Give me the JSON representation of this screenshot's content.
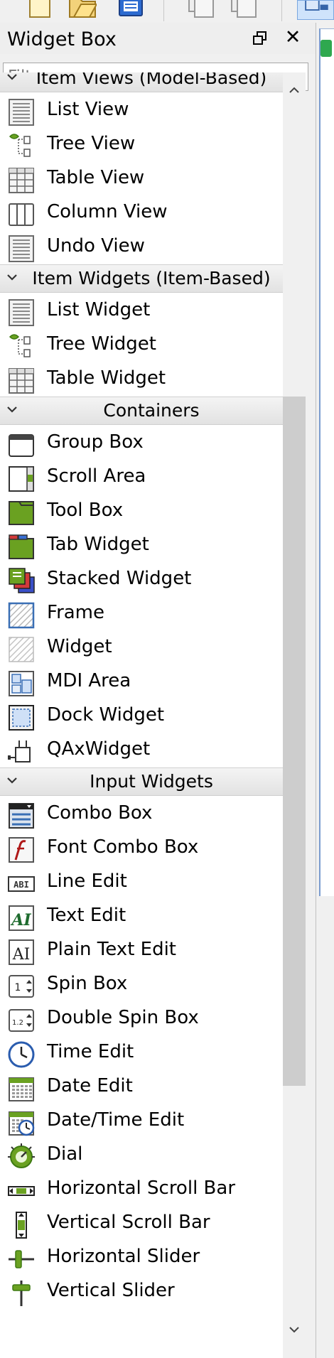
{
  "dock": {
    "title": "Widget Box",
    "filter_placeholder": "Filter",
    "float_icon": "float-icon",
    "close_glyph": "✕"
  },
  "categories": [
    {
      "label": "Item Views (Model-Based)",
      "items": [
        {
          "label": "List View",
          "icon": "list-view-icon"
        },
        {
          "label": "Tree View",
          "icon": "tree-view-icon"
        },
        {
          "label": "Table View",
          "icon": "table-view-icon"
        },
        {
          "label": "Column View",
          "icon": "column-view-icon"
        },
        {
          "label": "Undo View",
          "icon": "undo-view-icon"
        }
      ]
    },
    {
      "label": "Item Widgets (Item-Based)",
      "items": [
        {
          "label": "List Widget",
          "icon": "list-widget-icon"
        },
        {
          "label": "Tree Widget",
          "icon": "tree-widget-icon"
        },
        {
          "label": "Table Widget",
          "icon": "table-widget-icon"
        }
      ]
    },
    {
      "label": "Containers",
      "items": [
        {
          "label": "Group Box",
          "icon": "group-box-icon"
        },
        {
          "label": "Scroll Area",
          "icon": "scroll-area-icon"
        },
        {
          "label": "Tool Box",
          "icon": "tool-box-icon"
        },
        {
          "label": "Tab Widget",
          "icon": "tab-widget-icon"
        },
        {
          "label": "Stacked Widget",
          "icon": "stacked-widget-icon"
        },
        {
          "label": "Frame",
          "icon": "frame-icon"
        },
        {
          "label": "Widget",
          "icon": "widget-icon"
        },
        {
          "label": "MDI Area",
          "icon": "mdi-area-icon"
        },
        {
          "label": "Dock Widget",
          "icon": "dock-widget-icon"
        },
        {
          "label": "QAxWidget",
          "icon": "qaxwidget-icon"
        }
      ]
    },
    {
      "label": "Input Widgets",
      "items": [
        {
          "label": "Combo Box",
          "icon": "combo-box-icon"
        },
        {
          "label": "Font Combo Box",
          "icon": "font-combo-box-icon"
        },
        {
          "label": "Line Edit",
          "icon": "line-edit-icon",
          "glyph": "ABI"
        },
        {
          "label": "Text Edit",
          "icon": "text-edit-icon",
          "glyph": "AI"
        },
        {
          "label": "Plain Text Edit",
          "icon": "plain-text-edit-icon",
          "glyph": "AI"
        },
        {
          "label": "Spin Box",
          "icon": "spin-box-icon",
          "glyph": "1"
        },
        {
          "label": "Double Spin Box",
          "icon": "double-spin-box-icon",
          "glyph": "1.2"
        },
        {
          "label": "Time Edit",
          "icon": "time-edit-icon"
        },
        {
          "label": "Date Edit",
          "icon": "date-edit-icon"
        },
        {
          "label": "Date/Time Edit",
          "icon": "date-time-edit-icon"
        },
        {
          "label": "Dial",
          "icon": "dial-icon"
        },
        {
          "label": "Horizontal Scroll Bar",
          "icon": "horizontal-scroll-bar-icon"
        },
        {
          "label": "Vertical Scroll Bar",
          "icon": "vertical-scroll-bar-icon"
        },
        {
          "label": "Horizontal Slider",
          "icon": "horizontal-slider-icon"
        },
        {
          "label": "Vertical Slider",
          "icon": "vertical-slider-icon"
        }
      ]
    }
  ],
  "scrollbar": {
    "up_icon": "scroll-up-icon",
    "down_icon": "scroll-down-icon",
    "position": 0.25
  },
  "colors": {
    "category_bg": "#e6e6e6",
    "list_bg": "#ffffff",
    "accent": "#3a7bd5",
    "icon_green": "#6aa121"
  }
}
